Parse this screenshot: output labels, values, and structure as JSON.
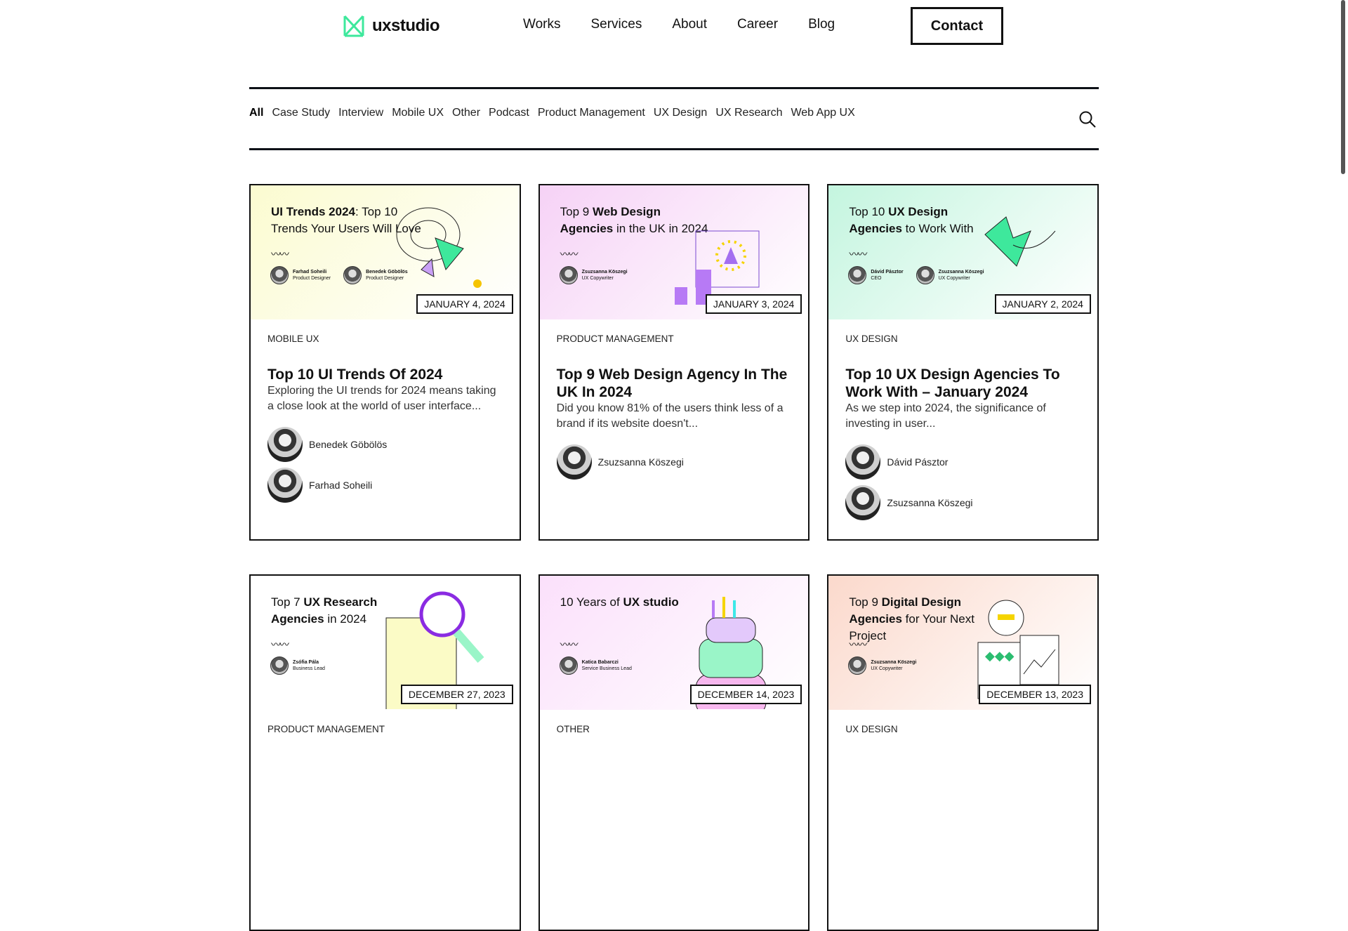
{
  "brand": {
    "name": "uxstudio",
    "accent": "#3ee89c"
  },
  "nav": {
    "items": [
      "Works",
      "Services",
      "About",
      "Career",
      "Blog"
    ],
    "contact": "Contact"
  },
  "filters": {
    "items": [
      "All",
      "Case Study",
      "Interview",
      "Mobile UX",
      "Other",
      "Podcast",
      "Product Management",
      "UX Design",
      "UX Research",
      "Web App UX"
    ],
    "active": "All",
    "search_icon": "search-icon"
  },
  "cards": [
    {
      "bg": "#fbfbd0",
      "thumb_title_bold": "UI Trends 2024",
      "thumb_title_rest": ": Top 10 Trends Your Users Will Love",
      "thumb_authors": [
        {
          "name": "Farhad Soheili",
          "role": "Product Designer"
        },
        {
          "name": "Benedek Göbölös",
          "role": "Product Designer"
        }
      ],
      "date": "JANUARY 4, 2024",
      "category": "MOBILE UX",
      "title": "Top 10 UI Trends Of 2024",
      "desc": "Exploring the UI trends for 2024 means taking a close look at the world of user interface...",
      "authors": [
        "Benedek Göbölös",
        "Farhad Soheili"
      ]
    },
    {
      "bg": "#f6d2f6",
      "thumb_title_pre": "Top 9 ",
      "thumb_title_bold": "Web Design Agencies",
      "thumb_title_rest": " in the UK in 2024",
      "thumb_authors": [
        {
          "name": "Zsuzsanna Köszegi",
          "role": "UX Copywriter"
        }
      ],
      "date": "JANUARY 3, 2024",
      "category": "PRODUCT MANAGEMENT",
      "title": "Top 9 Web Design Agency In The UK In 2024",
      "desc": "Did you know 81% of the users think less of a brand if its website doesn't...",
      "authors": [
        "Zsuzsanna Köszegi"
      ]
    },
    {
      "bg": "#c4f5df",
      "thumb_title_pre": "Top 10 ",
      "thumb_title_bold": "UX Design Agencies",
      "thumb_title_rest": " to Work With",
      "thumb_authors": [
        {
          "name": "Dávid Pásztor",
          "role": "CEO"
        },
        {
          "name": "Zsuzsanna Köszegi",
          "role": "UX Copywriter"
        }
      ],
      "date": "JANUARY 2, 2024",
      "category": "UX DESIGN",
      "title": "Top 10 UX Design Agencies To Work With – January 2024",
      "desc": "As we step into 2024, the significance of investing in user...",
      "authors": [
        "Dávid Pásztor",
        "Zsuzsanna Köszegi"
      ]
    },
    {
      "bg": "#ffffff",
      "thumb_title_pre": "Top 7 ",
      "thumb_title_bold": "UX Research Agencies",
      "thumb_title_rest": " in 2024",
      "thumb_authors": [
        {
          "name": "Zsófia Pála",
          "role": "Business Lead"
        }
      ],
      "date": "DECEMBER 27, 2023",
      "category": "PRODUCT MANAGEMENT"
    },
    {
      "bg": "#fbe0fb",
      "thumb_title_pre": "10 Years of ",
      "thumb_title_bold": "UX studio",
      "thumb_title_rest": "",
      "thumb_authors": [
        {
          "name": "Katica Babarczi",
          "role": "Service Business Lead"
        }
      ],
      "date": "DECEMBER 14, 2023",
      "category": "OTHER"
    },
    {
      "bg": "#fbd9cc",
      "thumb_title_pre": "Top 9 ",
      "thumb_title_bold": "Digital Design Agencies",
      "thumb_title_rest": " for Your Next Project",
      "thumb_authors": [
        {
          "name": "Zsuzsanna Köszegi",
          "role": "UX Copywriter"
        }
      ],
      "date": "DECEMBER 13, 2023",
      "category": "UX DESIGN"
    }
  ]
}
